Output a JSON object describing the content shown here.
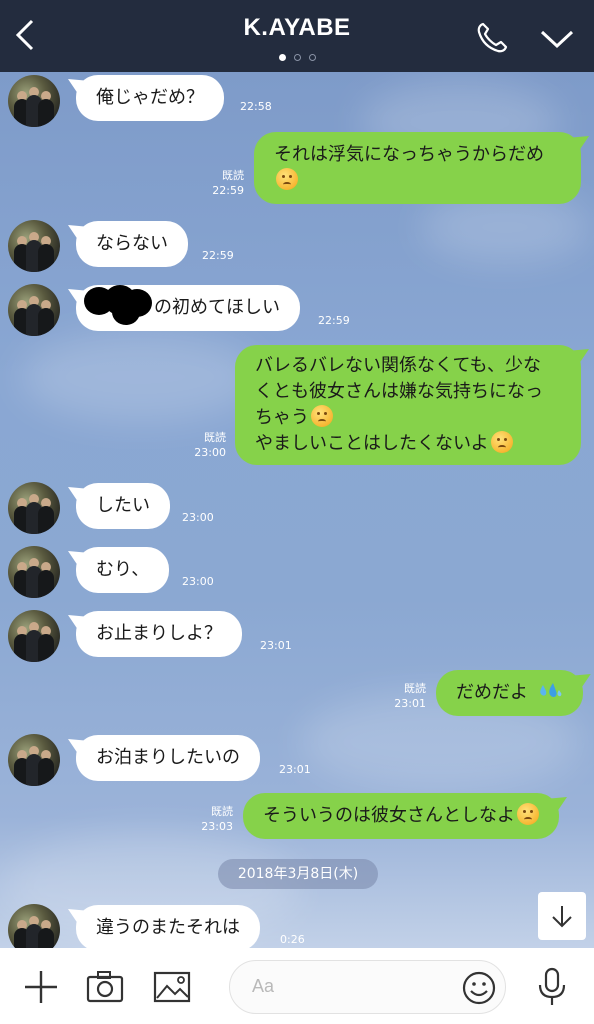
{
  "header": {
    "title": "K.AYABE",
    "page_dots": 3,
    "active_dot": 0
  },
  "messages": [
    {
      "side": "in",
      "text": "俺じゃだめ？",
      "time": "22:58"
    },
    {
      "side": "out",
      "lines": [
        "それは浮気になっちゃうからだめ"
      ],
      "emoji_end": true,
      "read": "既読",
      "time": "22:59"
    },
    {
      "side": "in",
      "text": "ならない",
      "time": "22:59"
    },
    {
      "side": "in",
      "text": "の初めてほしい",
      "time": "22:59",
      "redacted_prefix": true
    },
    {
      "side": "out",
      "lines": [
        "バレるバレない関係なくても、少な",
        "くとも彼女さんは嫌な気持ちになっ",
        "ちゃう",
        "やましいことはしたくないよ"
      ],
      "read": "既読",
      "time": "23:00"
    },
    {
      "side": "in",
      "text": "したい",
      "time": "23:00"
    },
    {
      "side": "in",
      "text": "むり、",
      "time": "23:00"
    },
    {
      "side": "in",
      "text": "お止まりしよ？",
      "time": "23:01"
    },
    {
      "side": "out",
      "text": "だめだよ",
      "read": "既読",
      "time": "23:01"
    },
    {
      "side": "in",
      "text": "お泊まりしたいの",
      "time": "23:01"
    },
    {
      "side": "out",
      "text": "そういうのは彼女さんとしなよ",
      "read": "既読",
      "time": "23:03"
    },
    {
      "side": "in",
      "text": "違うのまたそれは",
      "time": "0:26"
    }
  ],
  "date_separator": "2018年3月8日(木)",
  "input": {
    "placeholder": "Aa"
  },
  "icons": {
    "back": "back-arrow-icon",
    "call": "phone-icon",
    "menu": "chevron-down-icon",
    "scroll": "arrow-down-icon",
    "add": "plus-icon",
    "camera": "camera-icon",
    "gallery": "image-icon",
    "emoji": "smiley-icon",
    "mic": "microphone-icon"
  },
  "colors": {
    "header_bg": "#232c3e",
    "outgoing_bubble": "#86d24a",
    "incoming_bubble": "#ffffff",
    "chat_bg": "#8aa7d3"
  }
}
